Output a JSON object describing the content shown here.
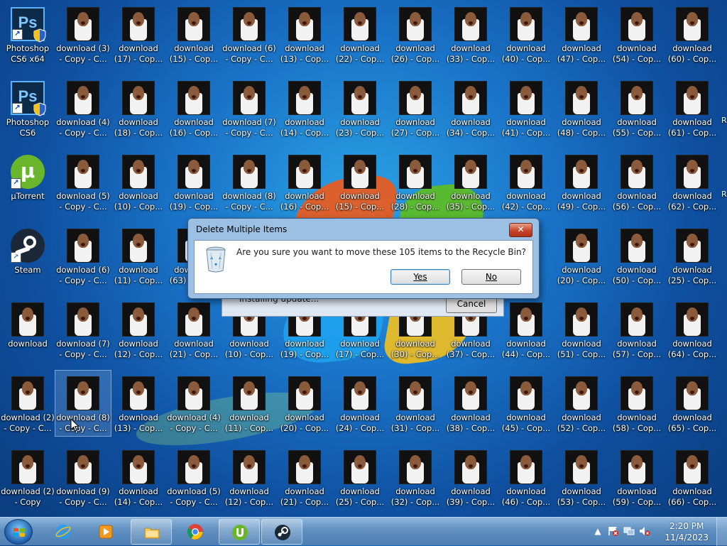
{
  "desktop": {
    "app_icons": [
      {
        "label": "Photoshop\nCS6 x64",
        "icon": "photoshop-icon"
      },
      {
        "label": "Photoshop\nCS6",
        "icon": "photoshop-icon"
      },
      {
        "label": "µTorrent",
        "icon": "utorrent-icon"
      },
      {
        "label": "Steam",
        "icon": "steam-icon"
      }
    ],
    "file_icons": [
      {
        "label": "download (3)\n- Copy - C..."
      },
      {
        "label": "download\n(17) - Cop..."
      },
      {
        "label": "download\n(15) - Cop..."
      },
      {
        "label": "download (6)\n- Copy - C..."
      },
      {
        "label": "download\n(13) - Cop..."
      },
      {
        "label": "download\n(22) - Cop..."
      },
      {
        "label": "download\n(26) - Cop..."
      },
      {
        "label": "download\n(33) - Cop..."
      },
      {
        "label": "download\n(40) - Cop..."
      },
      {
        "label": "download\n(47) - Cop..."
      },
      {
        "label": "download\n(54) - Cop..."
      },
      {
        "label": "download\n(60) - Cop..."
      },
      {
        "label": "download (4)\n- Copy - C..."
      },
      {
        "label": "download\n(18) - Cop..."
      },
      {
        "label": "download\n(16) - Cop..."
      },
      {
        "label": "download (7)\n- Copy - C..."
      },
      {
        "label": "download\n(14) - Cop..."
      },
      {
        "label": "download\n(23) - Cop..."
      },
      {
        "label": "download\n(27) - Cop..."
      },
      {
        "label": "download\n(34) - Cop..."
      },
      {
        "label": "download\n(41) - Cop..."
      },
      {
        "label": "download\n(48) - Cop..."
      },
      {
        "label": "download\n(55) - Cop..."
      },
      {
        "label": "download\n(61) - Cop..."
      },
      {
        "label": "download (5)\n- Copy - C..."
      },
      {
        "label": "download\n(10) - Cop..."
      },
      {
        "label": "download\n(19) - Cop..."
      },
      {
        "label": "download (8)\n- Copy - C..."
      },
      {
        "label": "download\n(16) - Cop..."
      },
      {
        "label": "download\n(15) - Cop..."
      },
      {
        "label": "download\n(28) - Cop..."
      },
      {
        "label": "download\n(35) - Cop..."
      },
      {
        "label": "download\n(42) - Cop..."
      },
      {
        "label": "download\n(49) - Cop..."
      },
      {
        "label": "download\n(56) - Cop..."
      },
      {
        "label": "download\n(62) - Cop..."
      },
      {
        "label": "download (6)\n- Copy - C..."
      },
      {
        "label": "download\n(11) - Cop..."
      },
      {
        "label": "download\n(20) - Cop..."
      },
      {
        "label": "download\n(50) - Cop..."
      },
      {
        "label": "download\n(25) - Cop..."
      },
      {
        "label": "download\n(63) - Cop..."
      },
      {
        "label": "download"
      },
      {
        "label": "download (7)\n- Copy - C..."
      },
      {
        "label": "download\n(12) - Cop..."
      },
      {
        "label": "download\n(21) - Cop..."
      },
      {
        "label": "download\n(10) - Cop..."
      },
      {
        "label": "download\n(19) - Cop..."
      },
      {
        "label": "download\n(17) - Cop..."
      },
      {
        "label": "download\n(30) - Cop..."
      },
      {
        "label": "download\n(37) - Cop..."
      },
      {
        "label": "download\n(44) - Cop..."
      },
      {
        "label": "download\n(51) - Cop..."
      },
      {
        "label": "download\n(57) - Cop..."
      },
      {
        "label": "download\n(64) - Cop..."
      },
      {
        "label": "download (2)\n- Copy - C..."
      },
      {
        "label": "download (8)\n- Copy - C..."
      },
      {
        "label": "download\n(13) - Cop..."
      },
      {
        "label": "download (4)\n- Copy - C..."
      },
      {
        "label": "download\n(11) - Cop..."
      },
      {
        "label": "download\n(20) - Cop..."
      },
      {
        "label": "download\n(24) - Cop..."
      },
      {
        "label": "download\n(31) - Cop..."
      },
      {
        "label": "download\n(38) - Cop..."
      },
      {
        "label": "download\n(45) - Cop..."
      },
      {
        "label": "download\n(52) - Cop..."
      },
      {
        "label": "download\n(58) - Cop..."
      },
      {
        "label": "download\n(65) - Cop..."
      },
      {
        "label": "download (2)\n- Copy"
      },
      {
        "label": "download (9)\n- Copy - C..."
      },
      {
        "label": "download\n(14) - Cop..."
      },
      {
        "label": "download (5)\n- Copy - C..."
      },
      {
        "label": "download\n(12) - Cop..."
      },
      {
        "label": "download\n(21) - Cop..."
      },
      {
        "label": "download\n(25) - Cop..."
      },
      {
        "label": "download\n(32) - Cop..."
      },
      {
        "label": "download\n(39) - Cop..."
      },
      {
        "label": "download\n(46) - Cop..."
      },
      {
        "label": "download\n(53) - Cop..."
      },
      {
        "label": "download\n(59) - Cop..."
      },
      {
        "label": "download\n(66) - Cop..."
      }
    ],
    "right_edge_clip": [
      "R",
      "R"
    ]
  },
  "background_window": {
    "status_text": "Installing update...",
    "cancel_label": "Cancel"
  },
  "dialog": {
    "title": "Delete Multiple Items",
    "close_glyph": "✕",
    "message": "Are you sure you want to move these 105 items to the Recycle Bin?",
    "yes_label": "Yes",
    "no_label": "No"
  },
  "taskbar": {
    "items": [
      {
        "name": "internet-explorer",
        "icon": "ie-icon",
        "state": "pinned"
      },
      {
        "name": "media-player",
        "icon": "media-player-icon",
        "state": "pinned"
      },
      {
        "name": "file-explorer",
        "icon": "folder-icon",
        "state": "open"
      },
      {
        "name": "chrome",
        "icon": "chrome-icon",
        "state": "pinned"
      },
      {
        "name": "utorrent",
        "icon": "utorrent-icon",
        "state": "open"
      },
      {
        "name": "steam",
        "icon": "steam-icon",
        "state": "open"
      }
    ],
    "clock_time": "2:20 PM",
    "clock_date": "11/4/2023"
  },
  "colors": {
    "dialog_frame": "#9cc0e4",
    "close_button": "#c8452a",
    "taskbar": "#5f8fc0"
  }
}
